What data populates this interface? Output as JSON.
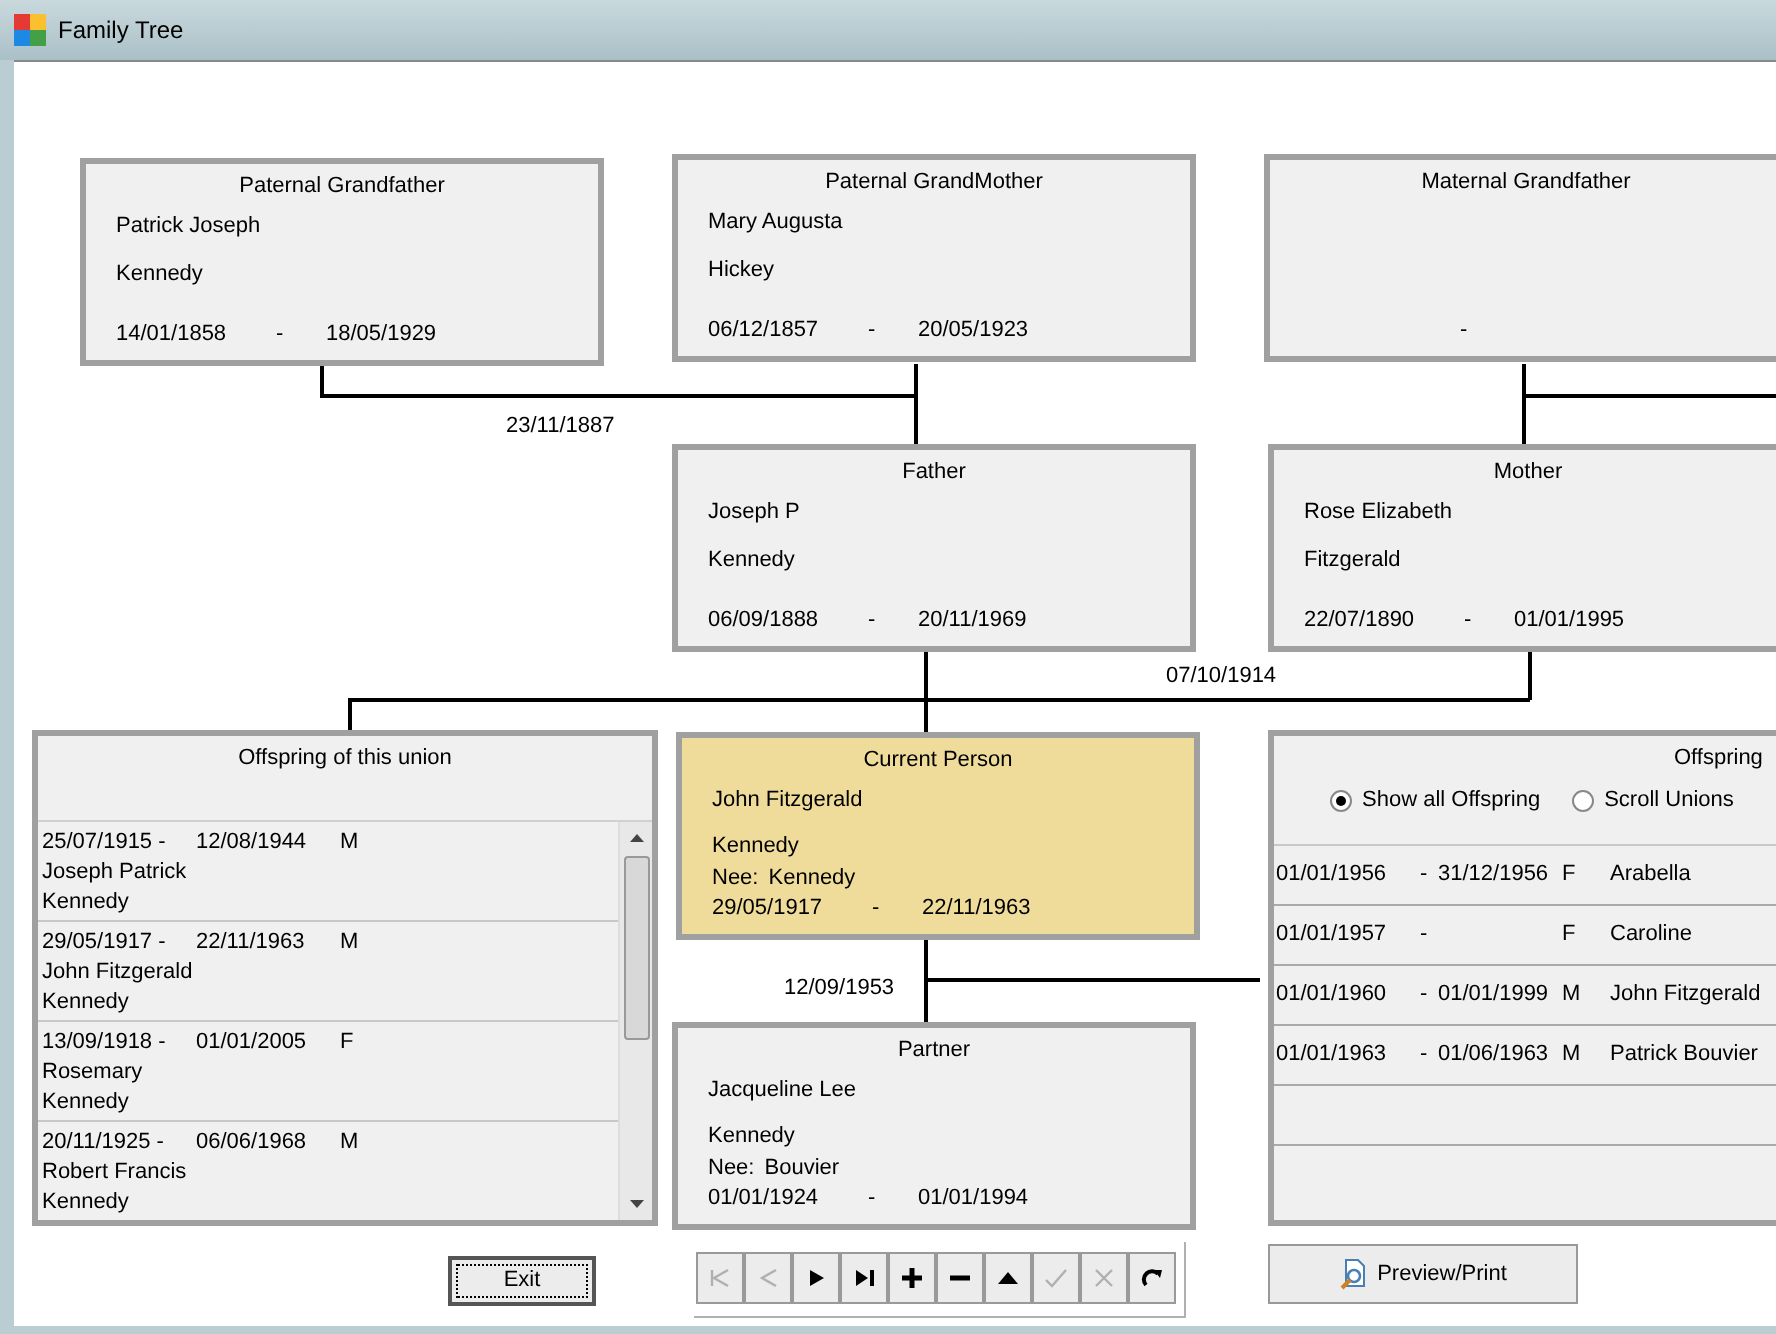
{
  "window": {
    "title": "Family Tree"
  },
  "persons": [
    {
      "kind": "paternal_grandfather",
      "heading": "Paternal Grandfather",
      "first_names": "Patrick Joseph",
      "surname": "Kennedy",
      "birth": "14/01/1858",
      "separator": "-",
      "death": "18/05/1929",
      "selected": false
    },
    {
      "kind": "paternal_grandmother",
      "heading": "Paternal GrandMother",
      "first_names": "Mary Augusta",
      "surname": "Hickey",
      "birth": "06/12/1857",
      "separator": "-",
      "death": "20/05/1923",
      "selected": false
    },
    {
      "kind": "maternal_grandfather",
      "heading": "Maternal Grandfather",
      "separator": "-",
      "selected": false
    },
    {
      "kind": "father",
      "heading": "Father",
      "first_names": "Joseph P",
      "surname": "Kennedy",
      "birth": "06/09/1888",
      "separator": "-",
      "death": "20/11/1969",
      "selected": false
    },
    {
      "kind": "mother",
      "heading": "Mother",
      "first_names": "Rose Elizabeth",
      "surname": "Fitzgerald",
      "birth": "22/07/1890",
      "separator": "-",
      "death": "01/01/1995",
      "selected": false
    },
    {
      "kind": "current",
      "heading": "Current Person",
      "first_names": "John Fitzgerald",
      "surname": "Kennedy",
      "nee_label": "Nee:",
      "nee": "Kennedy",
      "birth": "29/05/1917",
      "separator": "-",
      "death": "22/11/1963",
      "selected": true
    },
    {
      "kind": "partner",
      "heading": "Partner",
      "first_names": "Jacqueline Lee",
      "surname": "Kennedy",
      "nee_label": "Nee:",
      "nee": "Bouvier",
      "birth": "01/01/1924",
      "separator": "-",
      "death": "01/01/1994",
      "selected": false
    }
  ],
  "union_dates": [
    "23/11/1887",
    "07/10/1914",
    "12/09/1953"
  ],
  "offspring_of_union": {
    "title": "Offspring of this union",
    "rows": [
      {
        "birth": "25/07/1915 -",
        "death": "12/08/1944",
        "sex": "M",
        "first_names": "Joseph Patrick",
        "surname": "Kennedy"
      },
      {
        "birth": "29/05/1917 -",
        "death": "22/11/1963",
        "sex": "M",
        "first_names": "John Fitzgerald",
        "surname": "Kennedy"
      },
      {
        "birth": "13/09/1918 -",
        "death": "01/01/2005",
        "sex": "F",
        "first_names": "Rosemary",
        "surname": "Kennedy"
      },
      {
        "birth": "20/11/1925 -",
        "death": "06/06/1968",
        "sex": "M",
        "first_names": "Robert Francis",
        "surname": "Kennedy"
      }
    ]
  },
  "offspring": {
    "title": "Offspring",
    "options": [
      {
        "label": "Show all Offspring",
        "selected": true
      },
      {
        "label": "Scroll Unions",
        "selected": false
      }
    ],
    "rows": [
      {
        "birth": "01/01/1956",
        "separator": "-",
        "death": "31/12/1956",
        "sex": "F",
        "name": "Arabella"
      },
      {
        "birth": "01/01/1957",
        "separator": "-",
        "sex": "F",
        "name": "Caroline"
      },
      {
        "birth": "01/01/1960",
        "separator": "-",
        "death": "01/01/1999",
        "sex": "M",
        "name": "John Fitzgerald"
      },
      {
        "birth": "01/01/1963",
        "separator": "-",
        "death": "01/06/1963",
        "sex": "M",
        "name": "Patrick Bouvier"
      }
    ]
  },
  "exit_button": "Exit",
  "toolbar": [
    {
      "kind": "first",
      "disabled": true
    },
    {
      "kind": "prev",
      "disabled": true
    },
    {
      "kind": "next",
      "disabled": false
    },
    {
      "kind": "last",
      "disabled": false
    },
    {
      "kind": "add",
      "disabled": false
    },
    {
      "kind": "remove",
      "disabled": false
    },
    {
      "kind": "up",
      "disabled": false
    },
    {
      "kind": "confirm",
      "disabled": true
    },
    {
      "kind": "cancel",
      "disabled": true
    },
    {
      "kind": "refresh",
      "disabled": false
    }
  ],
  "preview_button": "Preview/Print"
}
